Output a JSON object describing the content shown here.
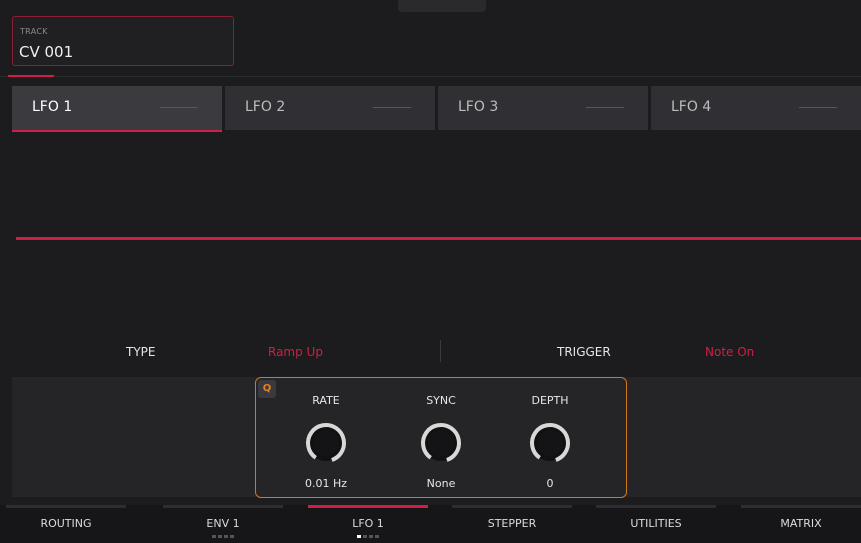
{
  "track": {
    "label": "TRACK",
    "value": "CV 001"
  },
  "tabs": [
    {
      "label": "LFO 1",
      "active": true
    },
    {
      "label": "LFO 2",
      "active": false
    },
    {
      "label": "LFO 3",
      "active": false
    },
    {
      "label": "LFO 4",
      "active": false
    }
  ],
  "params": {
    "type_label": "TYPE",
    "type_value": "Ramp Up",
    "trigger_label": "TRIGGER",
    "trigger_value": "Note On"
  },
  "qlink": {
    "badge": "Q"
  },
  "knobs": [
    {
      "title": "RATE",
      "value": "0.01 Hz"
    },
    {
      "title": "SYNC",
      "value": "None"
    },
    {
      "title": "DEPTH",
      "value": "0"
    }
  ],
  "nav": [
    {
      "label": "ROUTING",
      "active": false
    },
    {
      "label": "ENV 1",
      "active": false
    },
    {
      "label": "LFO 1",
      "active": true
    },
    {
      "label": "STEPPER",
      "active": false
    },
    {
      "label": "UTILITIES",
      "active": false
    },
    {
      "label": "MATRIX",
      "active": false
    }
  ],
  "colors": {
    "accent": "#d01e46",
    "qlink": "#d07a1e",
    "background": "#1c1c1e"
  }
}
